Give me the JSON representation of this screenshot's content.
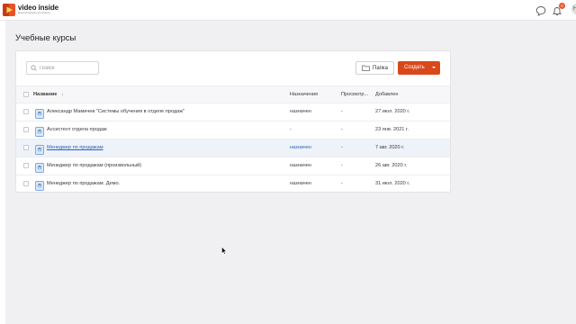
{
  "app": {
    "logo_title": "video inside",
    "logo_subtitle": "Видеоплатформа для бизнеса",
    "notification_count": "0",
    "avatar_initial": "Н"
  },
  "colors": {
    "accent": "#d9481b",
    "link": "#2a63b8",
    "row_highlight": "#eef2f9"
  },
  "page": {
    "title": "Учебные курсы"
  },
  "toolbar": {
    "search_placeholder": "Поиск",
    "folder_label": "Папка",
    "create_label": "Создать"
  },
  "table": {
    "headers": {
      "name": "Название",
      "sort_indicator": "↓",
      "assignments": "Назначения",
      "views": "Просмотр...",
      "added": "Добавлен"
    },
    "rows": [
      {
        "name": "Александр Мамичев \"Системы обучения в отделе продаж\"",
        "assignments": "назначен",
        "views": "-",
        "added": "27 июл. 2020 г."
      },
      {
        "name": "Ассистент отдела продаж",
        "assignments": "-",
        "views": "-",
        "added": "23 янв. 2021 г."
      },
      {
        "name": "Менеджер по продажам",
        "assignments": "назначен",
        "views": "-",
        "added": "7 авг. 2020 г."
      },
      {
        "name": "Менеджер по продажам (произвольный)",
        "assignments": "назначен",
        "views": "-",
        "added": "26 авг. 2020 г."
      },
      {
        "name": "Менеджер по продажам. Демо.",
        "assignments": "назначен",
        "views": "-",
        "added": "31 июл. 2020 г."
      }
    ]
  }
}
